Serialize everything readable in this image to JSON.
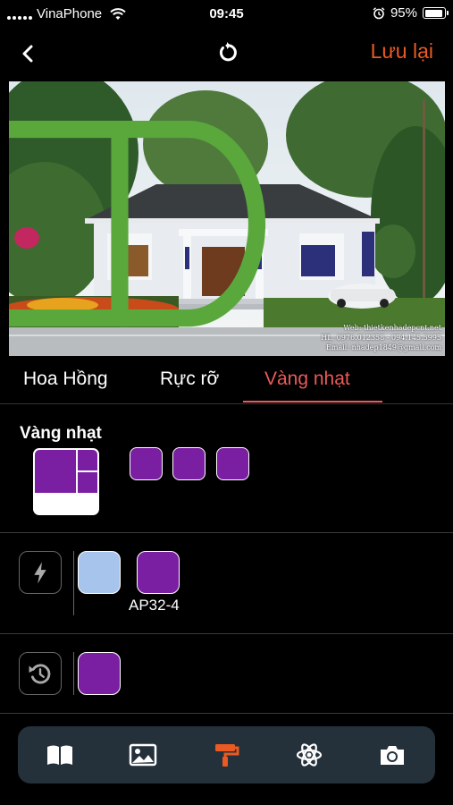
{
  "status_bar": {
    "carrier": "VinaPhone",
    "time": "09:45",
    "battery": "95%",
    "battery_level": 0.95
  },
  "nav": {
    "back_icon": "chevron-left-icon",
    "reset_icon": "undo-icon",
    "save_label": "Lưu lại",
    "accent_color": "#ea5a22"
  },
  "photo": {
    "watermark_lines": [
      "Web: thietkenhadepcnt.net",
      "HL: 0976.012358 - 094.145.5995",
      "Email: nhadep1849@gmail.com"
    ]
  },
  "tabs": [
    {
      "label": "Hoa Hồng",
      "active": false
    },
    {
      "label": "Rực rỡ",
      "active": false
    },
    {
      "label": "Vàng nhạt",
      "active": true
    }
  ],
  "tab_active_color": "#ea5a5a",
  "scheme": {
    "title": "Vàng nhạt",
    "main_color": "#7a1fa2",
    "swatches": [
      "#7a1fa2",
      "#7a1fa2",
      "#7a1fa2"
    ]
  },
  "suggested": {
    "icon": "lightning-icon",
    "swatches": [
      {
        "color": "#a7c4ec",
        "code": ""
      },
      {
        "color": "#7a1fa2",
        "code": "AP32-4"
      }
    ]
  },
  "history": {
    "icon": "history-icon",
    "swatches": [
      {
        "color": "#7a1fa2"
      }
    ]
  },
  "toolbar": {
    "items": [
      {
        "icon": "book-icon",
        "active": false
      },
      {
        "icon": "image-icon",
        "active": false
      },
      {
        "icon": "paint-roller-icon",
        "active": true
      },
      {
        "icon": "atom-icon",
        "active": false
      },
      {
        "icon": "camera-icon",
        "active": false
      }
    ],
    "active_color": "#ea5a22"
  }
}
